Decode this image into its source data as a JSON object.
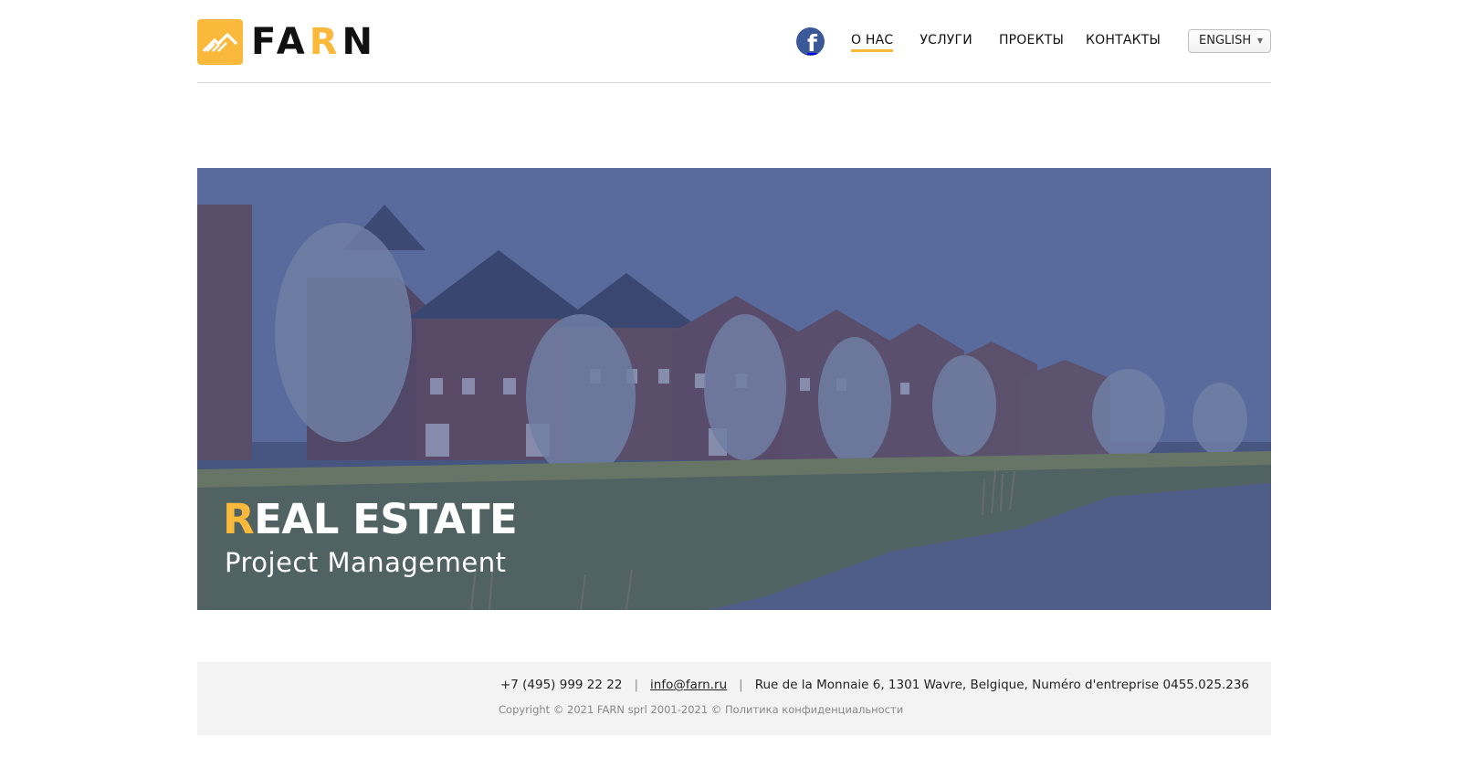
{
  "brand": {
    "logo_prefix": "FA",
    "logo_accent": "R",
    "logo_suffix": "N",
    "accent_color": "#fbb93b"
  },
  "social": {
    "icon": "facebook-icon",
    "label": "f",
    "color": "#3b5998"
  },
  "nav": {
    "items": [
      {
        "label": "О НАС",
        "active": true
      },
      {
        "label": "УСЛУГИ",
        "active": false
      },
      {
        "label": "ПРОЕКТЫ",
        "active": false
      },
      {
        "label": "КОНТАКТЫ",
        "active": false
      }
    ]
  },
  "language": {
    "selected": "ENGLISH",
    "caret": "▼"
  },
  "hero": {
    "title_accent": "R",
    "title_rest": "EAL ESTATE",
    "subtitle": "Project Management"
  },
  "footer": {
    "phone": "+7 (495) 999 22 22",
    "separator": "|",
    "email": "info@farn.ru",
    "address": "Rue de la Monnaie 6, 1301 Wavre, Belgique, Numéro d'entreprise  0455.025.236",
    "copyright": "Copyright © 2021 FARN sprl  2001-2021 © Политика конфиденциальности"
  }
}
